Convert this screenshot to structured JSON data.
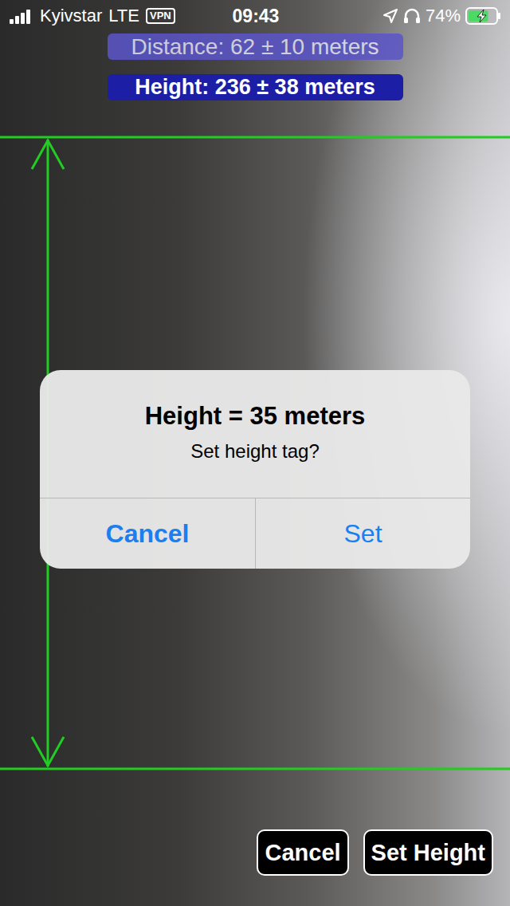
{
  "status_bar": {
    "carrier": "Kyivstar",
    "network": "LTE",
    "vpn": "VPN",
    "time": "09:43",
    "battery": "74%",
    "battery_level": 0.74,
    "charging": true,
    "signal_level": 1
  },
  "readouts": [
    {
      "label": "Distance: 62 ± 10 meters",
      "selected": false,
      "color": "#5b55c9"
    },
    {
      "label": "Height: 236 ± 38 meters",
      "selected": true,
      "color": "#1c1fa6"
    }
  ],
  "alert": {
    "title": "Height = 35 meters",
    "message": "Set height tag?",
    "buttons": [
      {
        "label": "Cancel",
        "preferred": true
      },
      {
        "label": "Set",
        "preferred": false
      }
    ]
  },
  "buttons": [
    {
      "label": "Cancel"
    },
    {
      "label": "Set Height"
    }
  ]
}
